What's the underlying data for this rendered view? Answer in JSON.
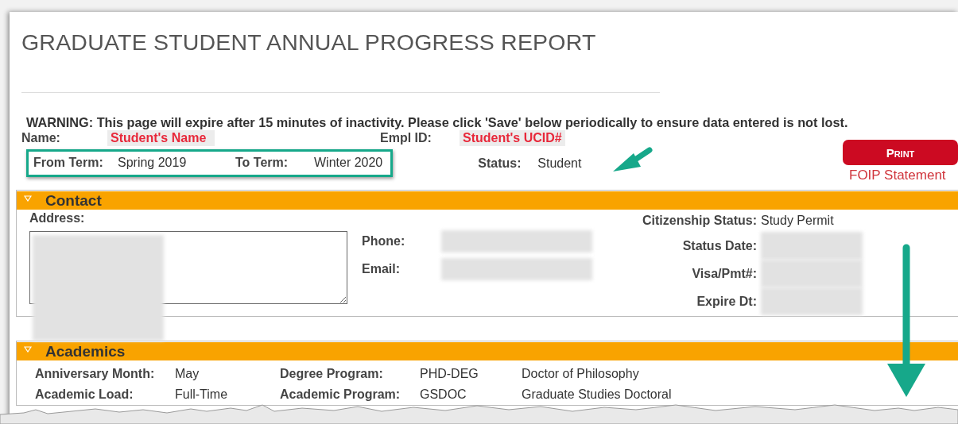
{
  "title": "GRADUATE STUDENT ANNUAL PROGRESS REPORT",
  "warning": "WARNING: This page will expire after 15 minutes of inactivity. Please click 'Save' below periodically to ensure data entered is not lost.",
  "name": {
    "label": "Name:",
    "value": "Student's Name"
  },
  "empl_id": {
    "label": "Empl ID:",
    "value": "Student's UCID#"
  },
  "from_term": {
    "label": "From Term:",
    "value": "Spring 2019"
  },
  "to_term": {
    "label": "To Term:",
    "value": "Winter 2020"
  },
  "status": {
    "label": "Status:",
    "value": "Student"
  },
  "print_button": "Print",
  "foip_link": "FOIP Statement",
  "contact": {
    "title": "Contact",
    "expanded": true,
    "address_label": "Address:",
    "middle_fields": [
      {
        "label": "Phone:",
        "redacted": true
      },
      {
        "label": "Email:",
        "redacted": true
      }
    ],
    "right_fields": [
      {
        "label": "Citizenship Status:",
        "value": "Study Permit",
        "redacted": false
      },
      {
        "label": "Status Date:",
        "redacted": true
      },
      {
        "label": "Visa/Pmt#:",
        "redacted": true
      },
      {
        "label": "Expire Dt:",
        "redacted": true
      }
    ]
  },
  "academics": {
    "title": "Academics",
    "expanded": true,
    "rows": [
      {
        "label_1": "Anniversary Month:",
        "value_1": "May",
        "label_2": "Degree Program:",
        "code": "PHD-DEG",
        "description": "Doctor of Philosophy"
      },
      {
        "label_1": "Academic Load:",
        "value_1": "Full-Time",
        "label_2": "Academic Program:",
        "code": "GSDOC",
        "description": "Graduate Studies Doctoral"
      }
    ]
  }
}
